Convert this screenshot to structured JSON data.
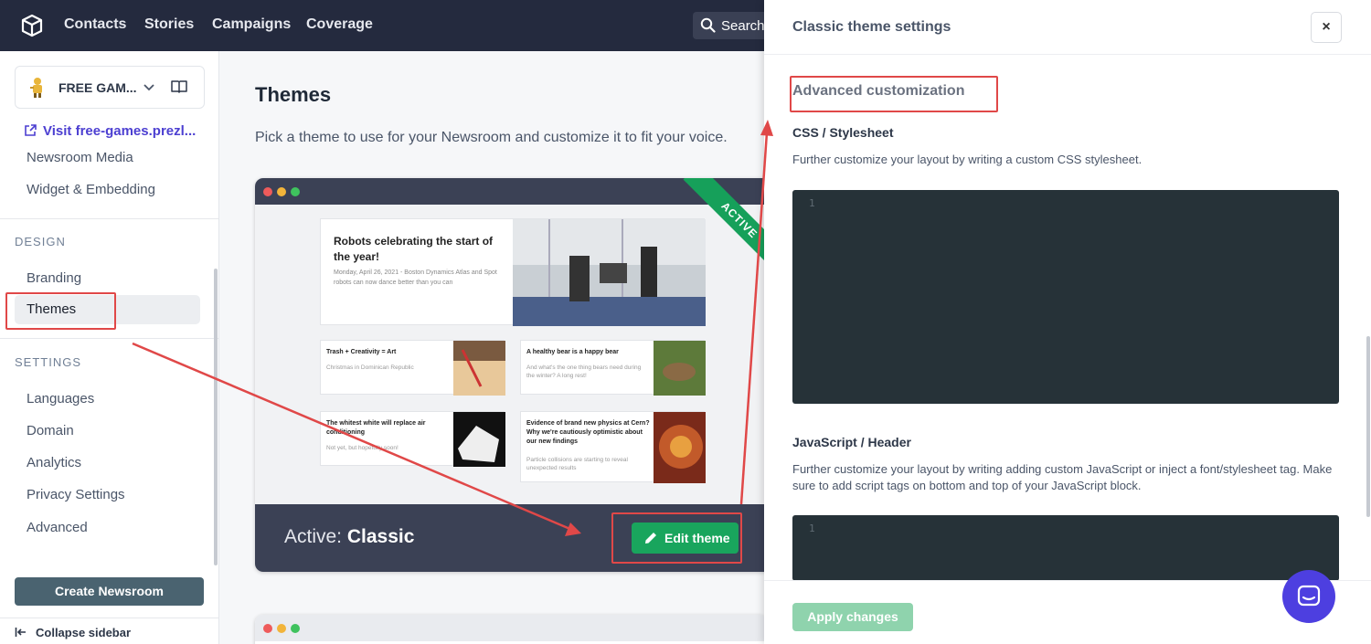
{
  "topbar": {
    "nav": [
      "Contacts",
      "Stories",
      "Campaigns",
      "Coverage"
    ],
    "search_label": "Search"
  },
  "sidebar": {
    "workspace_name": "FREE GAM...",
    "visit_link": "Visit free-games.prezl...",
    "top_items": [
      "Newsroom Media",
      "Widget & Embedding"
    ],
    "design_heading": "DESIGN",
    "design_items": [
      "Branding",
      "Themes"
    ],
    "settings_heading": "SETTINGS",
    "settings_items": [
      "Languages",
      "Domain",
      "Analytics",
      "Privacy Settings",
      "Advanced"
    ],
    "create_button": "Create Newsroom",
    "collapse_label": "Collapse sidebar"
  },
  "main": {
    "title": "Themes",
    "subtitle": "Pick a theme to use for your Newsroom and customize it to fit your voice.",
    "theme_card": {
      "ribbon": "ACTIVE",
      "active_prefix": "Active:",
      "active_name": "Classic",
      "edit_button": "Edit theme",
      "preview": {
        "hero_title": "Robots celebrating the start of the year!",
        "hero_desc": "Monday, April 26, 2021 - Boston Dynamics Atlas and Spot robots can now dance better than you can",
        "stories": [
          {
            "title": "Trash + Creativity = Art",
            "desc": "Christmas in Dominican Republic"
          },
          {
            "title": "A healthy bear is a happy bear",
            "desc": "And what's the one thing bears need during the winter? A long rest!"
          },
          {
            "title": "The whitest white will replace air conditioning",
            "desc": "Not yet, but hopefully soon!"
          },
          {
            "title": "Evidence of brand new physics at Cern? Why we're cautiously optimistic about our new findings",
            "desc": "Particle collisions are starting to reveal unexpected results"
          }
        ]
      }
    }
  },
  "panel": {
    "title": "Classic theme settings",
    "close_label": "×",
    "section_title": "Advanced customization",
    "css_label": "CSS / Stylesheet",
    "css_help": "Further customize your layout by writing a custom CSS stylesheet.",
    "css_line": "1",
    "js_label": "JavaScript / Header",
    "js_help": "Further customize your layout by writing adding custom JavaScript or inject a font/stylesheet tag. Make sure to add script tags on bottom and top of your JavaScript block.",
    "js_line": "1",
    "apply_button": "Apply changes"
  },
  "colors": {
    "topbar": "#242a3e",
    "accent_green": "#19a55d",
    "link_purple": "#4c3fd1",
    "annotation_red": "#e04848",
    "editor_bg": "#263238"
  },
  "icons": [
    "logo-icon",
    "search-icon",
    "chevron-down-icon",
    "book-icon",
    "external-link-icon",
    "pencil-icon",
    "collapse-icon",
    "chat-icon"
  ]
}
